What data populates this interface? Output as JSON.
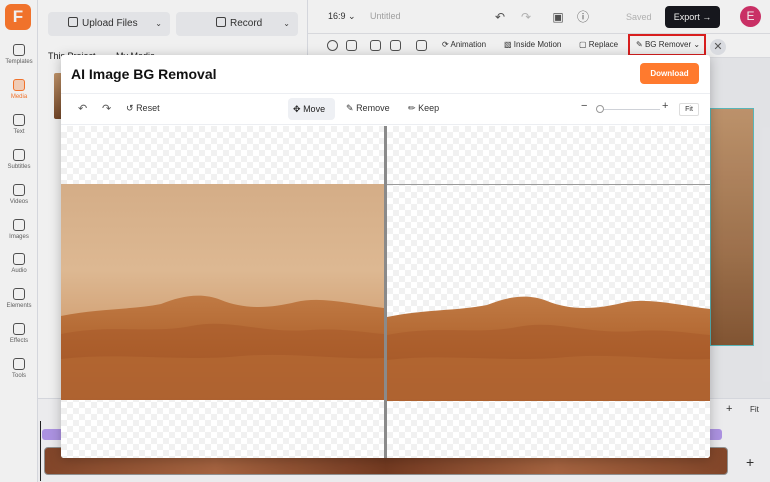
{
  "logo": {
    "letter": "F"
  },
  "sidebar": {
    "items": [
      {
        "label": "Templates",
        "icon": "templates-icon"
      },
      {
        "label": "Media",
        "icon": "media-icon",
        "active": true
      },
      {
        "label": "Text",
        "icon": "text-icon"
      },
      {
        "label": "Subtitles",
        "icon": "subtitles-icon"
      },
      {
        "label": "Videos",
        "icon": "videos-icon"
      },
      {
        "label": "Images",
        "icon": "images-icon"
      },
      {
        "label": "Audio",
        "icon": "audio-icon"
      },
      {
        "label": "Elements",
        "icon": "elements-icon"
      },
      {
        "label": "Effects",
        "icon": "effects-icon"
      },
      {
        "label": "Tools",
        "icon": "tools-icon"
      }
    ]
  },
  "media_panel": {
    "upload_label": "Upload Files",
    "record_label": "Record",
    "tabs": [
      "This Project",
      "My Media"
    ]
  },
  "topbar": {
    "aspect_ratio": "16:9",
    "title_placeholder": "Untitled",
    "saved_label": "Saved",
    "export_label": "Export",
    "avatar_letter": "E"
  },
  "toolbar2": {
    "animation_label": "Animation",
    "inside_motion_label": "Inside Motion",
    "replace_label": "Replace",
    "bg_remover_label": "BG Remover"
  },
  "modal": {
    "title": "AI Image BG Removal",
    "download_label": "Download",
    "reset_label": "Reset",
    "move_label": "Move",
    "remove_label": "Remove",
    "keep_label": "Keep",
    "fit_label": "Fit"
  },
  "timeline": {
    "fit_label": "Fit"
  },
  "colors": {
    "accent": "#ff7a2e",
    "highlight": "#e62020",
    "export_bg": "#18191f"
  }
}
